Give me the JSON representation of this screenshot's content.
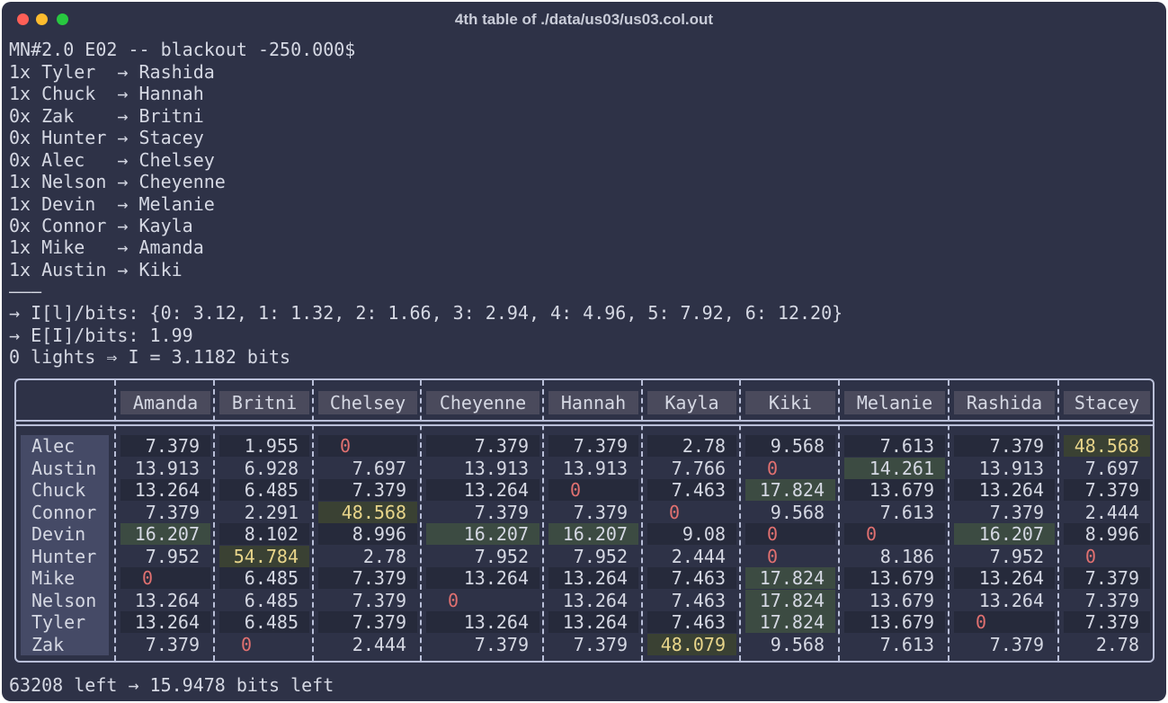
{
  "window": {
    "title": "4th table of ./data/us03/us03.col.out"
  },
  "header_line": "MN#2.0 E02 -- blackout -250.000$",
  "pairs": [
    "1x Tyler  → Rashida",
    "1x Chuck  → Hannah",
    "0x Zak    → Britni",
    "0x Hunter → Stacey",
    "0x Alec   → Chelsey",
    "1x Nelson → Cheyenne",
    "1x Devin  → Melanie",
    "0x Connor → Kayla",
    "1x Mike   → Amanda",
    "1x Austin → Kiki"
  ],
  "divider": "———",
  "info_lines": [
    "→ I[l]/bits: {0: 3.12, 1: 1.32, 2: 1.66, 3: 2.94, 4: 4.96, 5: 7.92, 6: 12.20}",
    "→ E[I]/bits: 1.99",
    "0 lights ⇒ I = 3.1182 bits"
  ],
  "table": {
    "columns": [
      "Amanda",
      "Britni",
      "Chelsey",
      "Cheyenne",
      "Hannah",
      "Kayla",
      "Kiki",
      "Melanie",
      "Rashida",
      "Stacey"
    ],
    "rows": [
      {
        "name": "Alec",
        "values": [
          "7.379",
          "1.955",
          "0",
          "7.379",
          "7.379",
          "2.78",
          "9.568",
          "7.613",
          "7.379",
          "48.568"
        ]
      },
      {
        "name": "Austin",
        "values": [
          "13.913",
          "6.928",
          "7.697",
          "13.913",
          "13.913",
          "7.766",
          "0",
          "14.261",
          "13.913",
          "7.697"
        ]
      },
      {
        "name": "Chuck",
        "values": [
          "13.264",
          "6.485",
          "7.379",
          "13.264",
          "0",
          "7.463",
          "17.824",
          "13.679",
          "13.264",
          "7.379"
        ]
      },
      {
        "name": "Connor",
        "values": [
          "7.379",
          "2.291",
          "48.568",
          "7.379",
          "7.379",
          "0",
          "9.568",
          "7.613",
          "7.379",
          "2.444"
        ]
      },
      {
        "name": "Devin",
        "values": [
          "16.207",
          "8.102",
          "8.996",
          "16.207",
          "16.207",
          "9.08",
          "0",
          "0",
          "16.207",
          "8.996"
        ]
      },
      {
        "name": "Hunter",
        "values": [
          "7.952",
          "54.784",
          "2.78",
          "7.952",
          "7.952",
          "2.444",
          "0",
          "8.186",
          "7.952",
          "0"
        ]
      },
      {
        "name": "Mike",
        "values": [
          "0",
          "6.485",
          "7.379",
          "13.264",
          "13.264",
          "7.463",
          "17.824",
          "13.679",
          "13.264",
          "7.379"
        ]
      },
      {
        "name": "Nelson",
        "values": [
          "13.264",
          "6.485",
          "7.379",
          "0",
          "13.264",
          "7.463",
          "17.824",
          "13.679",
          "13.264",
          "7.379"
        ]
      },
      {
        "name": "Tyler",
        "values": [
          "13.264",
          "6.485",
          "7.379",
          "13.264",
          "13.264",
          "7.463",
          "17.824",
          "13.679",
          "0",
          "7.379"
        ]
      },
      {
        "name": "Zak",
        "values": [
          "7.379",
          "0",
          "2.444",
          "7.379",
          "7.379",
          "48.079",
          "9.568",
          "7.613",
          "7.379",
          "2.78"
        ]
      }
    ]
  },
  "footer_line": "63208 left → 15.9478 bits left"
}
